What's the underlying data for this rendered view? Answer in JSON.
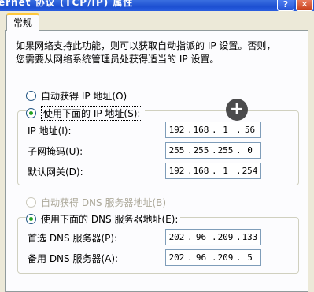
{
  "window": {
    "title": "ernet 协议 (TCP/IP) 属性",
    "help_label": "?",
    "close_label": "✕"
  },
  "tab": {
    "label": "常规"
  },
  "description": [
    "如果网络支持此功能，则可以获取自动指派的 IP 设置。否则，",
    "您需要从网络系统管理员处获得适当的 IP 设置。"
  ],
  "ip": {
    "auto_label": "自动获得 IP 地址(O)",
    "manual_label": "使用下面的 IP 地址(S):",
    "fields": [
      {
        "label": "IP 地址(I):",
        "octets": [
          "192",
          "168",
          "1",
          "56"
        ]
      },
      {
        "label": "子网掩码(U):",
        "octets": [
          "255",
          "255",
          "255",
          "0"
        ]
      },
      {
        "label": "默认网关(D):",
        "octets": [
          "192",
          "168",
          "1",
          "254"
        ]
      }
    ]
  },
  "dns": {
    "auto_label": "自动获得 DNS 服务器地址(B)",
    "manual_label": "使用下面的 DNS 服务器地址(E):",
    "fields": [
      {
        "label": "首选 DNS 服务器(P):",
        "octets": [
          "202",
          "96",
          "209",
          "133"
        ]
      },
      {
        "label": "备用 DNS 服务器(A):",
        "octets": [
          "202",
          "96",
          "209",
          "5"
        ]
      }
    ]
  },
  "overlay": {
    "icon": "plus-icon",
    "glyph": "+"
  }
}
